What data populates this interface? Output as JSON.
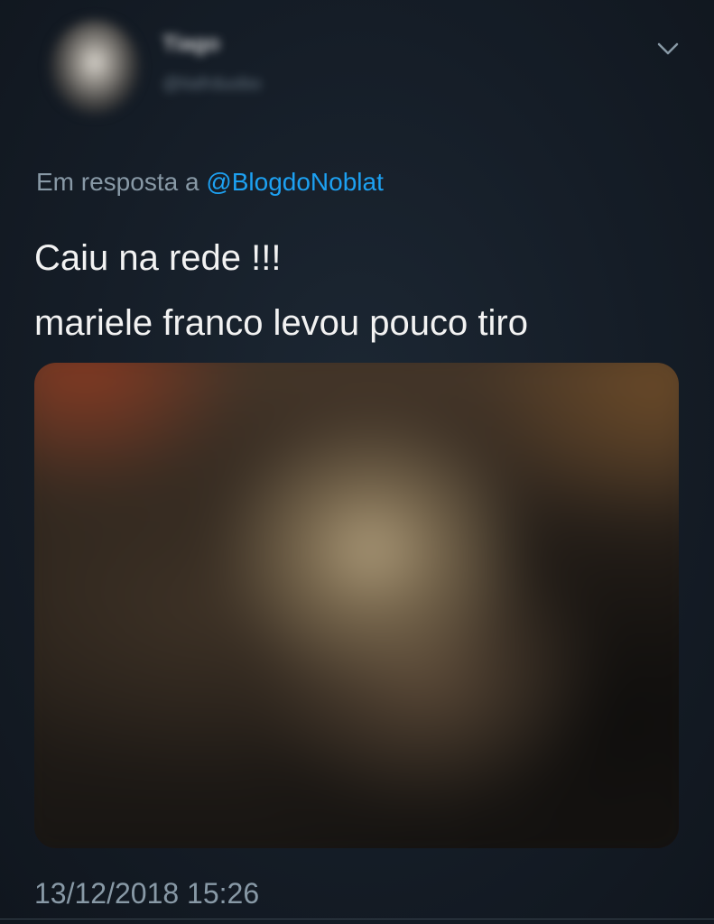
{
  "author": {
    "name": "Tiago",
    "handle": "@tiafrduobo"
  },
  "reply": {
    "prefix": "Em resposta a",
    "mention": "@BlogdoNoblat"
  },
  "tweet": {
    "lines": [
      "Caiu na rede !!!",
      "mariele franco levou pouco tiro"
    ]
  },
  "timestamp": "13/12/2018 15:26",
  "icons": {
    "menu": "chevron-down-icon"
  },
  "colors": {
    "background": "#15202b",
    "text": "#f2f2f2",
    "secondary": "#8899a6",
    "link": "#1da1f2"
  }
}
